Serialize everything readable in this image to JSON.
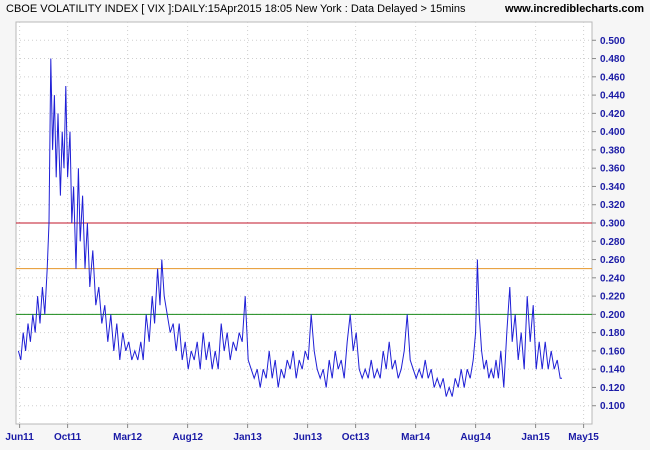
{
  "title": "CBOE VOLATILITY INDEX [ VIX ]:DAILY:15Apr2015 18:05 New York : Data Delayed > 15mins",
  "source": "www.incrediblecharts.com",
  "colors": {
    "series": "#1f1fd6",
    "axis_text": "#1a1aa6",
    "grid": "#cfcfcf",
    "ref_red": "#c0142a",
    "ref_orange": "#e6962a",
    "ref_green": "#1a8a1a"
  },
  "chart_data": {
    "type": "line",
    "xlabel": "",
    "ylabel": "",
    "ylim": [
      0.08,
      0.52
    ],
    "y_ticks": [
      "0.100",
      "0.120",
      "0.140",
      "0.160",
      "0.180",
      "0.200",
      "0.220",
      "0.240",
      "0.260",
      "0.280",
      "0.300",
      "0.320",
      "0.340",
      "0.360",
      "0.380",
      "0.400",
      "0.420",
      "0.440",
      "0.460",
      "0.480",
      "0.500"
    ],
    "x_ticks": [
      {
        "label": "Jun11",
        "t": 0
      },
      {
        "label": "Oct11",
        "t": 4
      },
      {
        "label": "Mar12",
        "t": 9
      },
      {
        "label": "Aug12",
        "t": 14
      },
      {
        "label": "Jan13",
        "t": 19
      },
      {
        "label": "Jun13",
        "t": 24
      },
      {
        "label": "Oct13",
        "t": 28
      },
      {
        "label": "Mar14",
        "t": 33
      },
      {
        "label": "Aug14",
        "t": 38
      },
      {
        "label": "Jan15",
        "t": 43
      },
      {
        "label": "May15",
        "t": 47
      }
    ],
    "t_range": [
      -0.3,
      47.7
    ],
    "reference_lines": [
      {
        "value": 0.3,
        "color": "#c0142a"
      },
      {
        "value": 0.25,
        "color": "#e6962a"
      },
      {
        "value": 0.2,
        "color": "#1a8a1a"
      }
    ],
    "grid": true,
    "series": [
      {
        "points": [
          [
            -0.1,
            0.16
          ],
          [
            0.1,
            0.15
          ],
          [
            0.3,
            0.18
          ],
          [
            0.5,
            0.16
          ],
          [
            0.7,
            0.19
          ],
          [
            0.9,
            0.17
          ],
          [
            1.1,
            0.2
          ],
          [
            1.3,
            0.18
          ],
          [
            1.5,
            0.22
          ],
          [
            1.7,
            0.19
          ],
          [
            1.9,
            0.23
          ],
          [
            2.1,
            0.2
          ],
          [
            2.3,
            0.25
          ],
          [
            2.45,
            0.3
          ],
          [
            2.6,
            0.48
          ],
          [
            2.75,
            0.38
          ],
          [
            2.9,
            0.44
          ],
          [
            3.05,
            0.35
          ],
          [
            3.2,
            0.42
          ],
          [
            3.4,
            0.33
          ],
          [
            3.55,
            0.4
          ],
          [
            3.7,
            0.36
          ],
          [
            3.85,
            0.45
          ],
          [
            4.0,
            0.35
          ],
          [
            4.2,
            0.4
          ],
          [
            4.35,
            0.3
          ],
          [
            4.5,
            0.34
          ],
          [
            4.7,
            0.25
          ],
          [
            4.9,
            0.36
          ],
          [
            5.05,
            0.28
          ],
          [
            5.25,
            0.33
          ],
          [
            5.45,
            0.25
          ],
          [
            5.65,
            0.3
          ],
          [
            5.85,
            0.23
          ],
          [
            6.1,
            0.27
          ],
          [
            6.35,
            0.21
          ],
          [
            6.6,
            0.23
          ],
          [
            6.85,
            0.19
          ],
          [
            7.1,
            0.21
          ],
          [
            7.35,
            0.17
          ],
          [
            7.6,
            0.2
          ],
          [
            7.85,
            0.16
          ],
          [
            8.1,
            0.19
          ],
          [
            8.35,
            0.15
          ],
          [
            8.6,
            0.18
          ],
          [
            8.85,
            0.16
          ],
          [
            9.1,
            0.17
          ],
          [
            9.35,
            0.15
          ],
          [
            9.6,
            0.16
          ],
          [
            9.85,
            0.15
          ],
          [
            10.1,
            0.17
          ],
          [
            10.3,
            0.15
          ],
          [
            10.55,
            0.2
          ],
          [
            10.8,
            0.17
          ],
          [
            11.05,
            0.22
          ],
          [
            11.25,
            0.19
          ],
          [
            11.5,
            0.25
          ],
          [
            11.7,
            0.21
          ],
          [
            11.85,
            0.26
          ],
          [
            12.05,
            0.22
          ],
          [
            12.3,
            0.2
          ],
          [
            12.55,
            0.18
          ],
          [
            12.8,
            0.19
          ],
          [
            13.05,
            0.16
          ],
          [
            13.3,
            0.19
          ],
          [
            13.55,
            0.15
          ],
          [
            13.8,
            0.17
          ],
          [
            14.05,
            0.14
          ],
          [
            14.3,
            0.16
          ],
          [
            14.55,
            0.15
          ],
          [
            14.8,
            0.17
          ],
          [
            15.05,
            0.14
          ],
          [
            15.3,
            0.18
          ],
          [
            15.55,
            0.15
          ],
          [
            15.8,
            0.17
          ],
          [
            16.05,
            0.14
          ],
          [
            16.3,
            0.16
          ],
          [
            16.55,
            0.14
          ],
          [
            16.8,
            0.19
          ],
          [
            17.05,
            0.16
          ],
          [
            17.3,
            0.18
          ],
          [
            17.55,
            0.15
          ],
          [
            17.8,
            0.17
          ],
          [
            18.05,
            0.16
          ],
          [
            18.3,
            0.18
          ],
          [
            18.55,
            0.17
          ],
          [
            18.8,
            0.22
          ],
          [
            19.05,
            0.15
          ],
          [
            19.3,
            0.14
          ],
          [
            19.55,
            0.13
          ],
          [
            19.8,
            0.14
          ],
          [
            20.05,
            0.12
          ],
          [
            20.3,
            0.14
          ],
          [
            20.55,
            0.13
          ],
          [
            20.8,
            0.16
          ],
          [
            21.05,
            0.13
          ],
          [
            21.3,
            0.15
          ],
          [
            21.55,
            0.12
          ],
          [
            21.8,
            0.14
          ],
          [
            22.05,
            0.13
          ],
          [
            22.3,
            0.15
          ],
          [
            22.55,
            0.14
          ],
          [
            22.8,
            0.16
          ],
          [
            23.05,
            0.13
          ],
          [
            23.3,
            0.15
          ],
          [
            23.55,
            0.14
          ],
          [
            23.8,
            0.16
          ],
          [
            24.05,
            0.15
          ],
          [
            24.3,
            0.2
          ],
          [
            24.55,
            0.16
          ],
          [
            24.8,
            0.14
          ],
          [
            25.05,
            0.13
          ],
          [
            25.3,
            0.14
          ],
          [
            25.55,
            0.12
          ],
          [
            25.8,
            0.15
          ],
          [
            26.05,
            0.13
          ],
          [
            26.3,
            0.16
          ],
          [
            26.55,
            0.14
          ],
          [
            26.8,
            0.15
          ],
          [
            27.05,
            0.13
          ],
          [
            27.3,
            0.17
          ],
          [
            27.55,
            0.2
          ],
          [
            27.8,
            0.16
          ],
          [
            28.05,
            0.18
          ],
          [
            28.3,
            0.14
          ],
          [
            28.55,
            0.13
          ],
          [
            28.8,
            0.14
          ],
          [
            29.05,
            0.13
          ],
          [
            29.3,
            0.15
          ],
          [
            29.55,
            0.13
          ],
          [
            29.8,
            0.14
          ],
          [
            30.05,
            0.13
          ],
          [
            30.3,
            0.16
          ],
          [
            30.55,
            0.14
          ],
          [
            30.8,
            0.17
          ],
          [
            31.05,
            0.14
          ],
          [
            31.3,
            0.15
          ],
          [
            31.55,
            0.13
          ],
          [
            31.8,
            0.14
          ],
          [
            32.05,
            0.16
          ],
          [
            32.3,
            0.2
          ],
          [
            32.55,
            0.15
          ],
          [
            32.8,
            0.14
          ],
          [
            33.05,
            0.13
          ],
          [
            33.3,
            0.14
          ],
          [
            33.55,
            0.13
          ],
          [
            33.8,
            0.15
          ],
          [
            34.05,
            0.13
          ],
          [
            34.3,
            0.14
          ],
          [
            34.55,
            0.12
          ],
          [
            34.8,
            0.13
          ],
          [
            35.05,
            0.12
          ],
          [
            35.3,
            0.13
          ],
          [
            35.55,
            0.11
          ],
          [
            35.8,
            0.12
          ],
          [
            36.05,
            0.11
          ],
          [
            36.3,
            0.13
          ],
          [
            36.55,
            0.12
          ],
          [
            36.8,
            0.14
          ],
          [
            37.05,
            0.12
          ],
          [
            37.3,
            0.14
          ],
          [
            37.55,
            0.13
          ],
          [
            37.8,
            0.15
          ],
          [
            38.0,
            0.18
          ],
          [
            38.15,
            0.26
          ],
          [
            38.3,
            0.2
          ],
          [
            38.5,
            0.16
          ],
          [
            38.7,
            0.14
          ],
          [
            38.9,
            0.15
          ],
          [
            39.1,
            0.13
          ],
          [
            39.3,
            0.14
          ],
          [
            39.5,
            0.13
          ],
          [
            39.7,
            0.15
          ],
          [
            39.9,
            0.13
          ],
          [
            40.1,
            0.16
          ],
          [
            40.35,
            0.12
          ],
          [
            40.6,
            0.18
          ],
          [
            40.85,
            0.23
          ],
          [
            41.05,
            0.17
          ],
          [
            41.3,
            0.2
          ],
          [
            41.55,
            0.15
          ],
          [
            41.8,
            0.18
          ],
          [
            42.05,
            0.14
          ],
          [
            42.3,
            0.22
          ],
          [
            42.55,
            0.17
          ],
          [
            42.8,
            0.21
          ],
          [
            43.05,
            0.14
          ],
          [
            43.3,
            0.17
          ],
          [
            43.55,
            0.14
          ],
          [
            43.8,
            0.17
          ],
          [
            44.05,
            0.14
          ],
          [
            44.3,
            0.16
          ],
          [
            44.55,
            0.14
          ],
          [
            44.8,
            0.15
          ],
          [
            45.05,
            0.13
          ],
          [
            45.2,
            0.13
          ]
        ]
      }
    ]
  }
}
